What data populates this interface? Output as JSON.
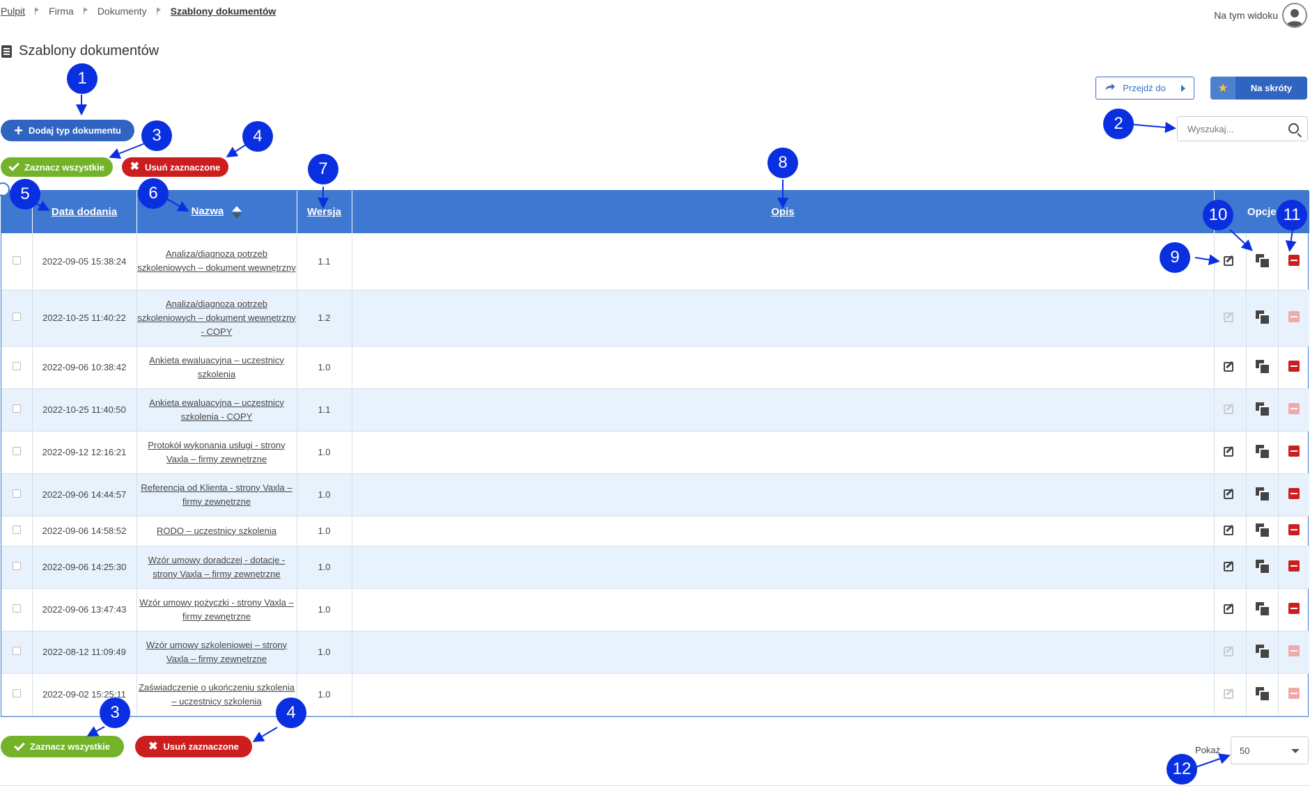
{
  "breadcrumb": {
    "items": [
      "Pulpit",
      "Firma",
      "Dokumenty",
      "Szablony dokumentów"
    ]
  },
  "view_user": {
    "label": "Na tym widoku"
  },
  "page": {
    "title": "Szablony dokumentów"
  },
  "toolbar": {
    "goto_label": "Przejdź do",
    "shortcut_label": "Na skróty",
    "add_label": "Dodaj typ dokumentu",
    "select_all_label": "Zaznacz wszystkie",
    "delete_selected_label": "Usuń zaznaczone"
  },
  "search": {
    "placeholder": "Wyszukaj..."
  },
  "table": {
    "headers": {
      "date": "Data dodania",
      "name": "Nazwa",
      "version": "Wersja",
      "description": "Opis",
      "options": "Opcje"
    },
    "rows": [
      {
        "date": "2022-09-05 15:38:24",
        "name": "Analiza/diagnoza potrzeb szkoleniowych – dokument wewnętrzny",
        "version": "1.1",
        "description": "",
        "editable": true
      },
      {
        "date": "2022-10-25 11:40:22",
        "name": "Analiza/diagnoza potrzeb szkoleniowych – dokument wewnętrzny - COPY",
        "version": "1.2",
        "description": "",
        "editable": false
      },
      {
        "date": "2022-09-06 10:38:42",
        "name": "Ankieta ewaluacyjna – uczestnicy szkolenia",
        "version": "1.0",
        "description": "",
        "editable": true
      },
      {
        "date": "2022-10-25 11:40:50",
        "name": "Ankieta ewaluacyjna – uczestnicy szkolenia - COPY",
        "version": "1.1",
        "description": "",
        "editable": false
      },
      {
        "date": "2022-09-12 12:16:21",
        "name": "Protokół wykonania usługi - strony Vaxla – firmy zewnętrzne",
        "version": "1.0",
        "description": "",
        "editable": true
      },
      {
        "date": "2022-09-06 14:44:57",
        "name": "Referencja od Klienta - strony Vaxla – firmy zewnętrzne",
        "version": "1.0",
        "description": "",
        "editable": true
      },
      {
        "date": "2022-09-06 14:58:52",
        "name": "RODO – uczestnicy szkolenia",
        "version": "1.0",
        "description": "",
        "editable": true
      },
      {
        "date": "2022-09-06 14:25:30",
        "name": "Wzór umowy doradczej - dotacje - strony Vaxla – firmy zewnętrzne",
        "version": "1.0",
        "description": "",
        "editable": true
      },
      {
        "date": "2022-09-06 13:47:43",
        "name": "Wzór umowy pożyczki - strony Vaxla – firmy zewnętrzne",
        "version": "1.0",
        "description": "",
        "editable": true
      },
      {
        "date": "2022-08-12 11:09:49",
        "name": "Wzór umowy szkoleniowej – strony Vaxla – firmy zewnętrzne",
        "version": "1.0",
        "description": "",
        "editable": false
      },
      {
        "date": "2022-09-02 15:25:11",
        "name": "Zaświadczenie o ukończeniu szkolenia – uczestnicy szkolenia",
        "version": "1.0",
        "description": "",
        "editable": false
      }
    ]
  },
  "pagination": {
    "show_label": "Pokaż",
    "page_size": "50"
  },
  "callouts": [
    "1",
    "2",
    "3",
    "4",
    "5",
    "6",
    "7",
    "8",
    "9",
    "10",
    "11",
    "3",
    "4",
    "12"
  ],
  "icons": {
    "edit": "edit-icon",
    "copy": "copy-icon",
    "delete": "delete-icon",
    "search": "search-icon",
    "star": "star-icon",
    "arrow": "share-arrow-icon",
    "user": "user-icon",
    "document": "document-icon"
  },
  "colors": {
    "primary": "#2f64c0",
    "header": "#3f78d0",
    "green": "#72b32a",
    "red": "#cc1e1e",
    "row_alt": "#e8f2fc",
    "callout": "#0a2fe0"
  }
}
